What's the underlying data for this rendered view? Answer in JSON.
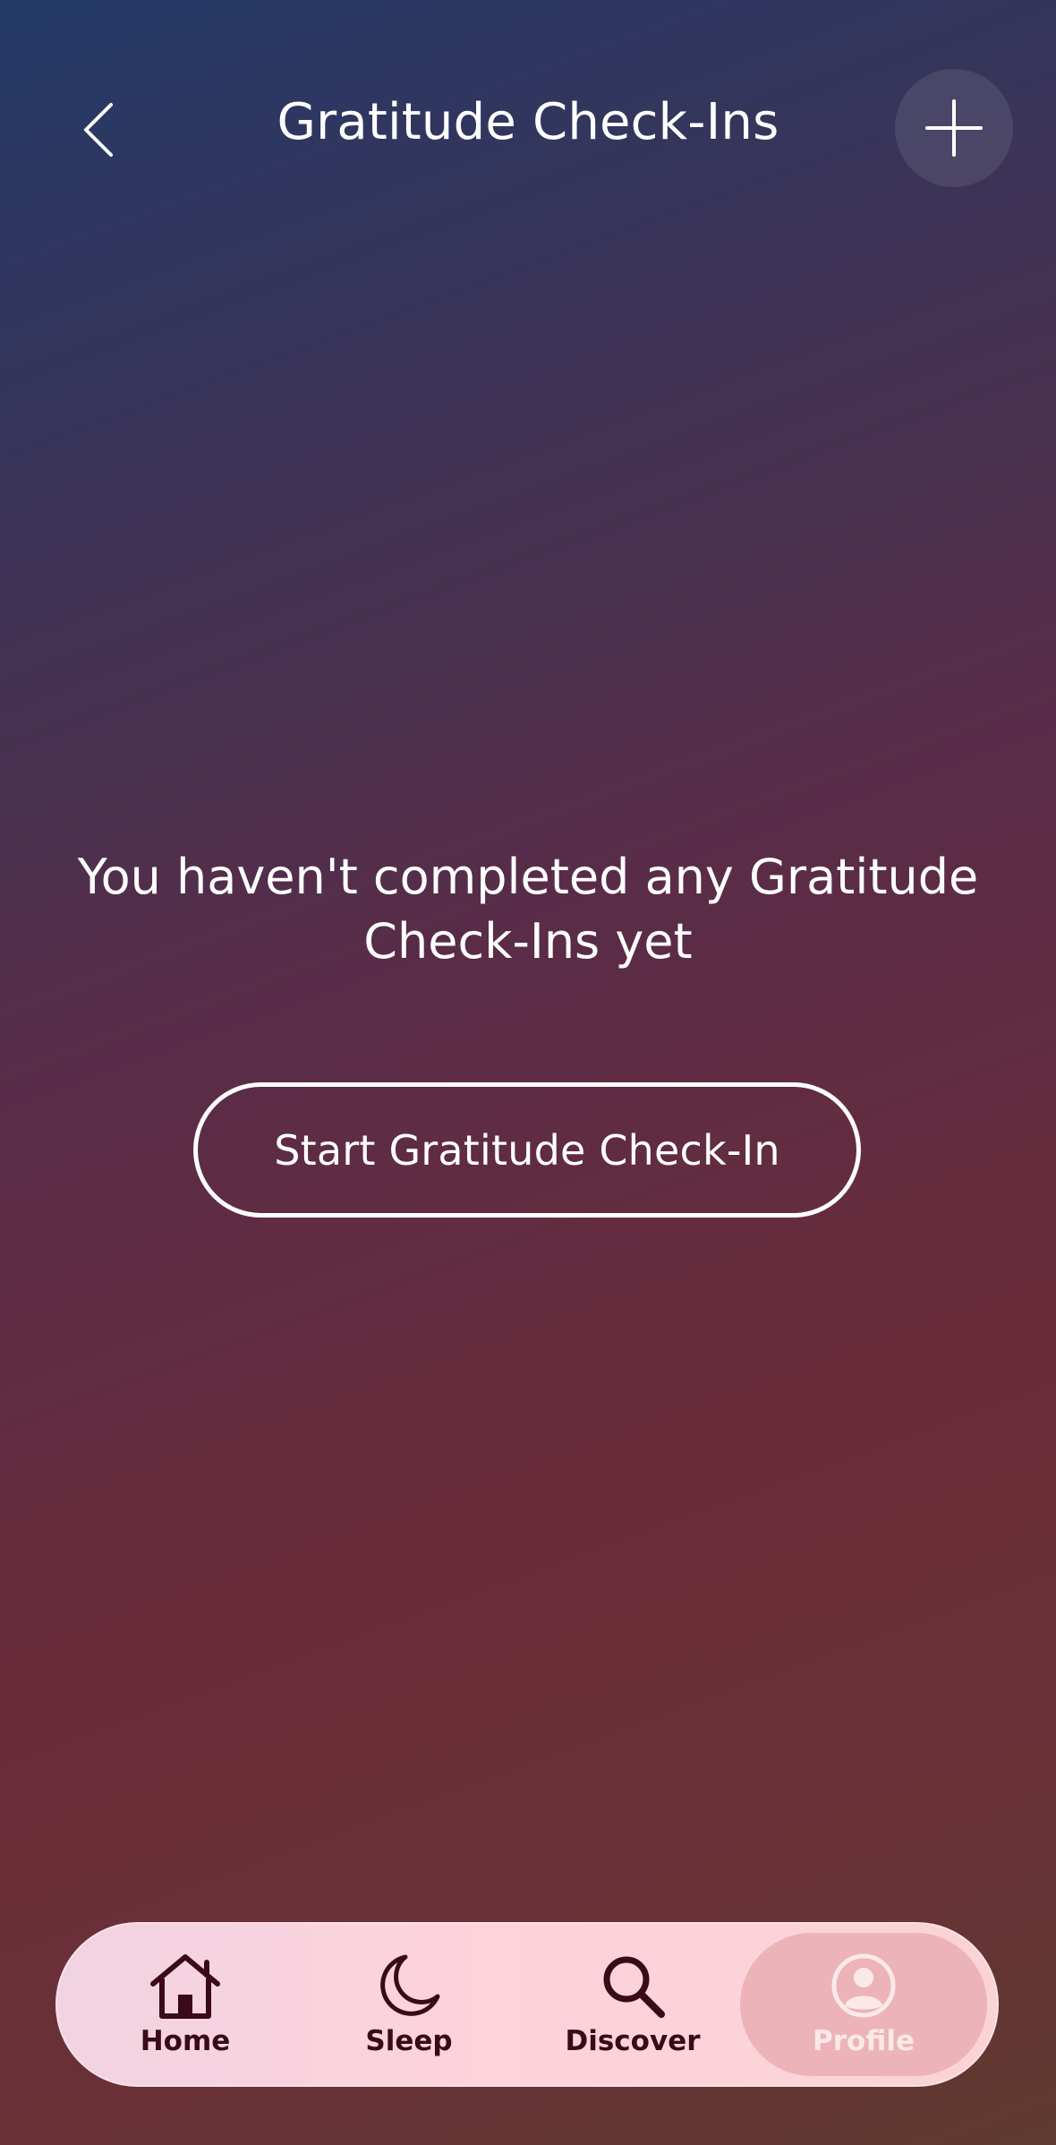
{
  "header": {
    "title": "Gratitude Check-Ins",
    "back_icon": "chevron-left-icon",
    "add_icon": "plus-icon"
  },
  "empty_state": {
    "message": "You haven't completed any Gratitude Check-Ins yet",
    "button_label": "Start Gratitude Check-In"
  },
  "nav": {
    "items": [
      {
        "label": "Home",
        "icon": "home-icon",
        "active": false
      },
      {
        "label": "Sleep",
        "icon": "moon-icon",
        "active": false
      },
      {
        "label": "Discover",
        "icon": "search-icon",
        "active": false
      },
      {
        "label": "Profile",
        "icon": "profile-icon",
        "active": true
      }
    ]
  },
  "colors": {
    "accent_dark": "#3a0a18",
    "nav_background": "#fdd3dc",
    "active_tab": "#ecb4b8"
  }
}
